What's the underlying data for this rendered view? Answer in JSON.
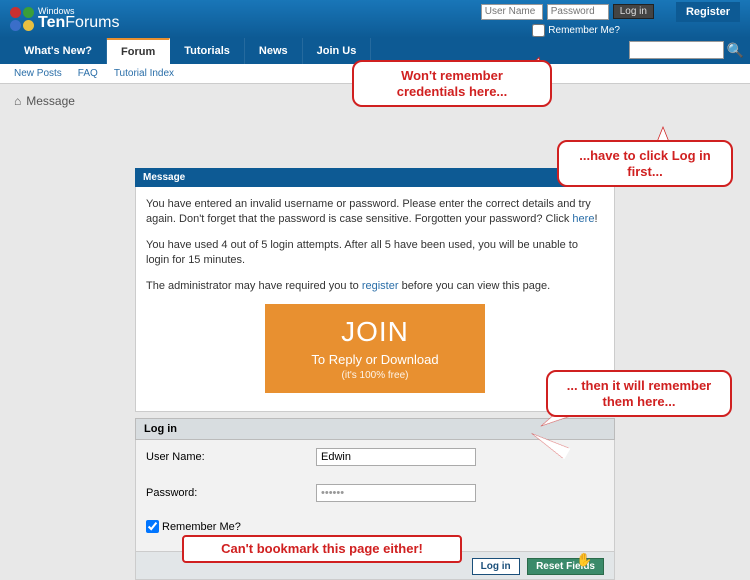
{
  "header": {
    "brand_small": "Windows",
    "brand_bold": "Ten",
    "brand_rest": "Forums",
    "username_placeholder": "User Name",
    "password_placeholder": "Password",
    "login_btn": "Log in",
    "register_btn": "Register",
    "remember_label": "Remember Me?"
  },
  "nav": {
    "tabs": [
      "What's New?",
      "Forum",
      "Tutorials",
      "News",
      "Join Us"
    ],
    "sub": [
      "New Posts",
      "FAQ",
      "Tutorial Index"
    ]
  },
  "breadcrumb": {
    "label": "Message"
  },
  "message": {
    "header": "Message",
    "p1a": "You have entered an invalid username or password. Please enter the correct details and try again. Don't forget that the password is case sensitive. Forgotten your password? Click ",
    "p1link": "here",
    "p1b": "!",
    "p2": "You have used 4 out of 5 login attempts. After all 5 have been used, you will be unable to login for 15 minutes.",
    "p3a": "The administrator may have required you to ",
    "p3link": "register",
    "p3b": " before you can view this page."
  },
  "join": {
    "line1": "JOIN",
    "line2": "To Reply or Download",
    "line3": "(it's 100% free)"
  },
  "login": {
    "header": "Log in",
    "user_label": "User Name:",
    "user_value": "Edwin",
    "pass_label": "Password:",
    "remember": "Remember Me?",
    "login_btn": "Log in",
    "reset_btn": "Reset Fields"
  },
  "callouts": {
    "c1": "Won't remember credentials here...",
    "c2": "...have to click Log in first...",
    "c3": "... then it will remember them here...",
    "c4": "Can't bookmark this page either!"
  }
}
